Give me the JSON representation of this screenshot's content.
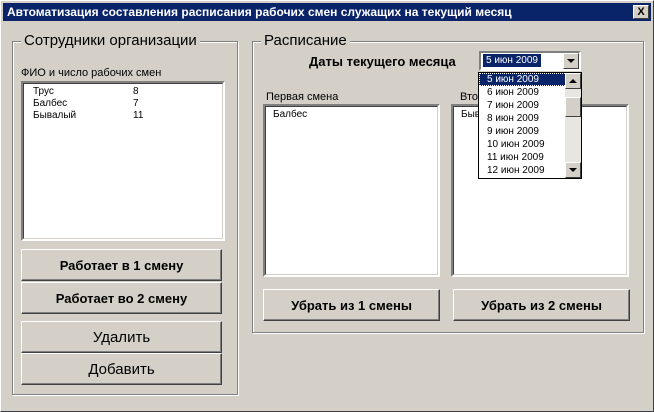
{
  "window": {
    "title": "Автоматизация составления расписания рабочих смен служащих на текущий месяц",
    "close_label": "X"
  },
  "employees": {
    "group_title": "Сотрудники организации",
    "list_label": "ФИО и число рабочих смен",
    "rows": [
      {
        "name": "Трус",
        "shifts": "8"
      },
      {
        "name": "Балбес",
        "shifts": "7"
      },
      {
        "name": "Бывалый",
        "shifts": "11"
      }
    ],
    "btn_shift1": "Работает в 1 смену",
    "btn_shift2": "Работает во 2 смену",
    "btn_delete": "Удалить",
    "btn_add": "Добавить"
  },
  "schedule": {
    "group_title": "Расписание",
    "date_label": "Даты текущего месяца",
    "selected_date": "5 июн 2009",
    "dropdown_dates": [
      "5 июн 2009",
      "6 июн 2009",
      "7 июн 2009",
      "8 июн 2009",
      "9 июн 2009",
      "10 июн 2009",
      "11 июн 2009",
      "12 июн 2009"
    ],
    "first_shift_label": "Первая смена",
    "first_shift_items": [
      "Балбес"
    ],
    "second_shift_label": "Вто",
    "second_shift_items": [
      "Быв"
    ],
    "btn_remove1": "Убрать из 1 смены",
    "btn_remove2": "Убрать из 2 смены"
  }
}
